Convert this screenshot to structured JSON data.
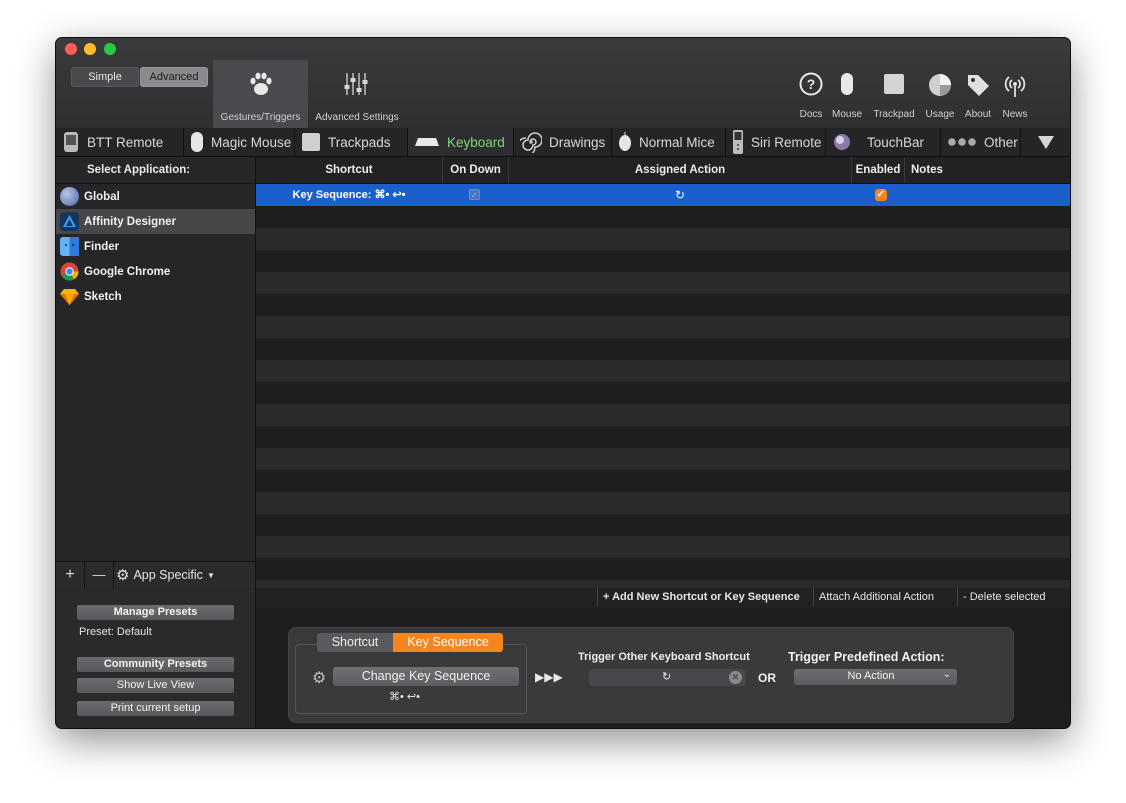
{
  "mode": {
    "simple": "Simple",
    "advanced": "Advanced"
  },
  "toolbar": {
    "gestures": "Gestures/Triggers",
    "advanced_settings": "Advanced Settings",
    "docs": "Docs",
    "mouse": "Mouse",
    "trackpad": "Trackpad",
    "usage": "Usage",
    "about": "About",
    "news": "News"
  },
  "tabs": [
    {
      "label": "BTT Remote"
    },
    {
      "label": "Magic Mouse"
    },
    {
      "label": "Trackpads"
    },
    {
      "label": "Keyboard"
    },
    {
      "label": "Drawings"
    },
    {
      "label": "Normal Mice"
    },
    {
      "label": "Siri Remote"
    },
    {
      "label": "TouchBar"
    },
    {
      "label": "Other"
    }
  ],
  "sidebar": {
    "header": "Select Application:",
    "apps": [
      {
        "label": "Global",
        "icon": "globe-icon"
      },
      {
        "label": "Affinity Designer",
        "icon": "affinity-designer-icon"
      },
      {
        "label": "Finder",
        "icon": "finder-icon"
      },
      {
        "label": "Google Chrome",
        "icon": "chrome-icon"
      },
      {
        "label": "Sketch",
        "icon": "sketch-icon"
      }
    ],
    "add": "+",
    "remove": "—",
    "app_specific": "App Specific"
  },
  "presets": {
    "manage": "Manage Presets",
    "current": "Preset: Default",
    "community": "Community Presets",
    "live_view": "Show Live View",
    "print": "Print current setup"
  },
  "table": {
    "columns": [
      "Shortcut",
      "On Down",
      "Assigned Action",
      "Enabled",
      "Notes"
    ],
    "rows": [
      {
        "shortcut": "Key Sequence: ⌘• ↩•",
        "on_down": false,
        "action": "↻",
        "enabled": true,
        "notes": ""
      }
    ]
  },
  "actions": {
    "add": "+ Add New Shortcut or Key Sequence",
    "attach": "Attach Additional Action",
    "delete": "- Delete selected"
  },
  "editor": {
    "seg_shortcut": "Shortcut",
    "seg_sequence": "Key Sequence",
    "change": "Change Key Sequence",
    "sequence": "⌘• ↩•",
    "arrows": "▶▶▶",
    "trigger_other": "Trigger Other Keyboard Shortcut",
    "or": "OR",
    "trigger_predefined": "Trigger Predefined Action:",
    "predefined_value": "No Action"
  },
  "colors": {
    "accent_green": "#7fd87a",
    "selection": "#1a5fcc",
    "orange": "#f5861f"
  }
}
